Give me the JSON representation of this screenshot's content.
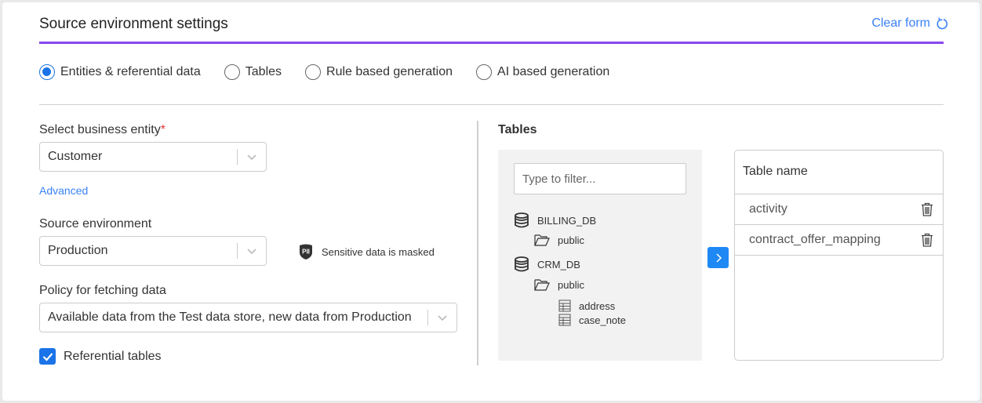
{
  "header": {
    "title": "Source environment settings",
    "clear_label": "Clear form",
    "accent_color": "#8b45ef"
  },
  "modes": [
    {
      "label": "Entities & referential data",
      "selected": true
    },
    {
      "label": "Tables",
      "selected": false
    },
    {
      "label": "Rule based generation",
      "selected": false
    },
    {
      "label": "AI based generation",
      "selected": false
    }
  ],
  "form": {
    "entity_label": "Select business entity",
    "required_mark": "*",
    "entity_value": "Customer",
    "advanced_label": "Advanced",
    "env_label": "Source environment",
    "env_value": "Production",
    "pii_badge": "PII",
    "pii_text": "Sensitive data is masked",
    "policy_label": "Policy for fetching data",
    "policy_value": "Available data from the Test data store, new data from Production",
    "referential_label": "Referential tables",
    "referential_checked": true
  },
  "tables": {
    "heading": "Tables",
    "filter_placeholder": "Type to filter...",
    "tree": {
      "db1": "BILLING_DB",
      "db1_schema": "public",
      "db2": "CRM_DB",
      "db2_schema": "public",
      "db2_tables": [
        "address",
        "case_note"
      ]
    },
    "column_header": "Table name",
    "selected": [
      "activity",
      "contract_offer_mapping"
    ]
  }
}
